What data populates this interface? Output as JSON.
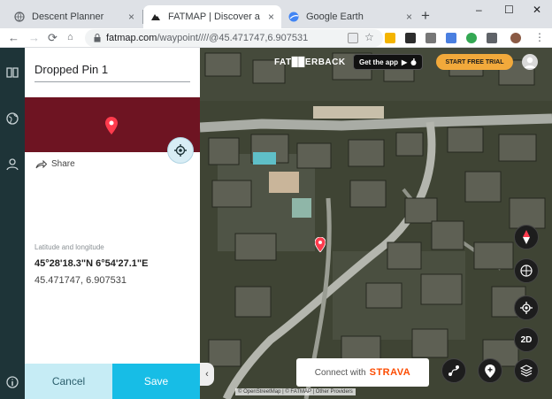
{
  "browser": {
    "tabs": [
      {
        "title": "Descent Planner",
        "close": "×"
      },
      {
        "title": "FATMAP | Discover a world of",
        "close": "×"
      },
      {
        "title": "Google Earth",
        "close": "×"
      }
    ],
    "new_tab": "+",
    "window": {
      "min": "–",
      "max": "☐",
      "close": "✕"
    },
    "url_host": "fatmap.com",
    "url_path": "/waypoint////@45.471747,6.907531"
  },
  "rail": {
    "icons": [
      "book-icon",
      "globe-icon",
      "user-icon",
      "info-icon"
    ]
  },
  "panel": {
    "pin_name": "Dropped Pin 1",
    "share_label": "Share",
    "coords_label": "Latitude and longitude",
    "coords_dms": "45°28'18.3\"N 6°54'27.1\"E",
    "coords_decimal": "45.471747, 6.907531",
    "cancel_label": "Cancel",
    "save_label": "Save",
    "hero_color": "#6e1422"
  },
  "map": {
    "logo_text": "FAT██ERBACK",
    "get_app_label": "Get the app",
    "trial_label": "START FREE TRIAL",
    "strava_prefix": "Connect with",
    "strava_brand": "STRAVA",
    "view_mode_label": "2D",
    "credit": "© OpenStreetMap | © FATMAP | Other Providers",
    "collapse_glyph": "‹"
  }
}
